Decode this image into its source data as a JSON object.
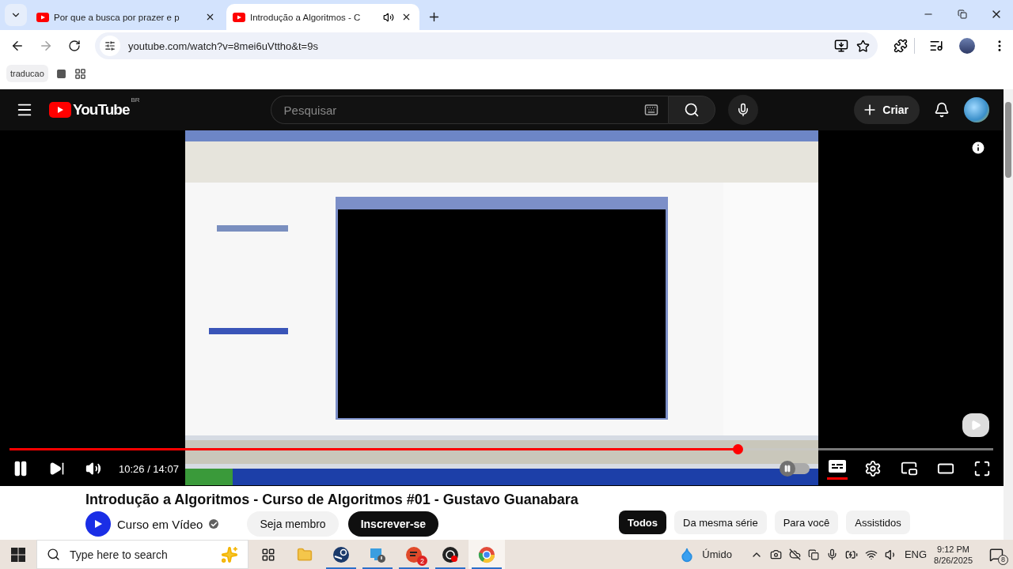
{
  "browser": {
    "tabs": [
      {
        "title": "Por que a busca por prazer e p",
        "selected": false,
        "audio": false
      },
      {
        "title": "Introdução a Algoritmos - C",
        "selected": true,
        "audio": true
      }
    ],
    "address": {
      "url": "youtube.com/watch?v=8mei6uVttho&t=9s"
    },
    "bookmark": "traducao"
  },
  "youtube": {
    "logo": "YouTube",
    "region": "BR",
    "search": {
      "placeholder": "Pesquisar"
    },
    "create": "Criar",
    "player": {
      "progress": {
        "level": 0.74
      },
      "time": "10:26 / 14:07",
      "playing": true,
      "captions": {
        "on": true
      },
      "autoplay": {
        "on": false
      }
    },
    "video_title": "Introdução a Algoritmos - Curso de Algoritmos #01 - Gustavo Guanabara",
    "channel": {
      "name": "Curso em Vídeo",
      "verified": true
    },
    "join": "Seja membro",
    "subscribe": "Inscrever-se",
    "chips": [
      {
        "label": "Todos",
        "selected": true
      },
      {
        "label": "Da mesma série",
        "selected": false
      },
      {
        "label": "Para você",
        "selected": false
      },
      {
        "label": "Assistidos",
        "selected": false
      }
    ]
  },
  "taskbar": {
    "search": {
      "placeholder": "Type here to search"
    },
    "apps": [
      {
        "kind": "taskview",
        "running": false,
        "active": false
      },
      {
        "kind": "explorer",
        "running": false,
        "active": false
      },
      {
        "kind": "steam",
        "running": true,
        "active": false
      },
      {
        "kind": "monitor",
        "running": true,
        "active": false
      },
      {
        "kind": "game",
        "running": true,
        "active": false,
        "badge": "2"
      },
      {
        "kind": "record",
        "running": true,
        "active": false
      },
      {
        "kind": "browser",
        "running": true,
        "active": true
      }
    ],
    "weather": "Úmido",
    "language": "ENG",
    "time": "9:12 PM",
    "date": "8/26/2025",
    "notifications": "8"
  }
}
